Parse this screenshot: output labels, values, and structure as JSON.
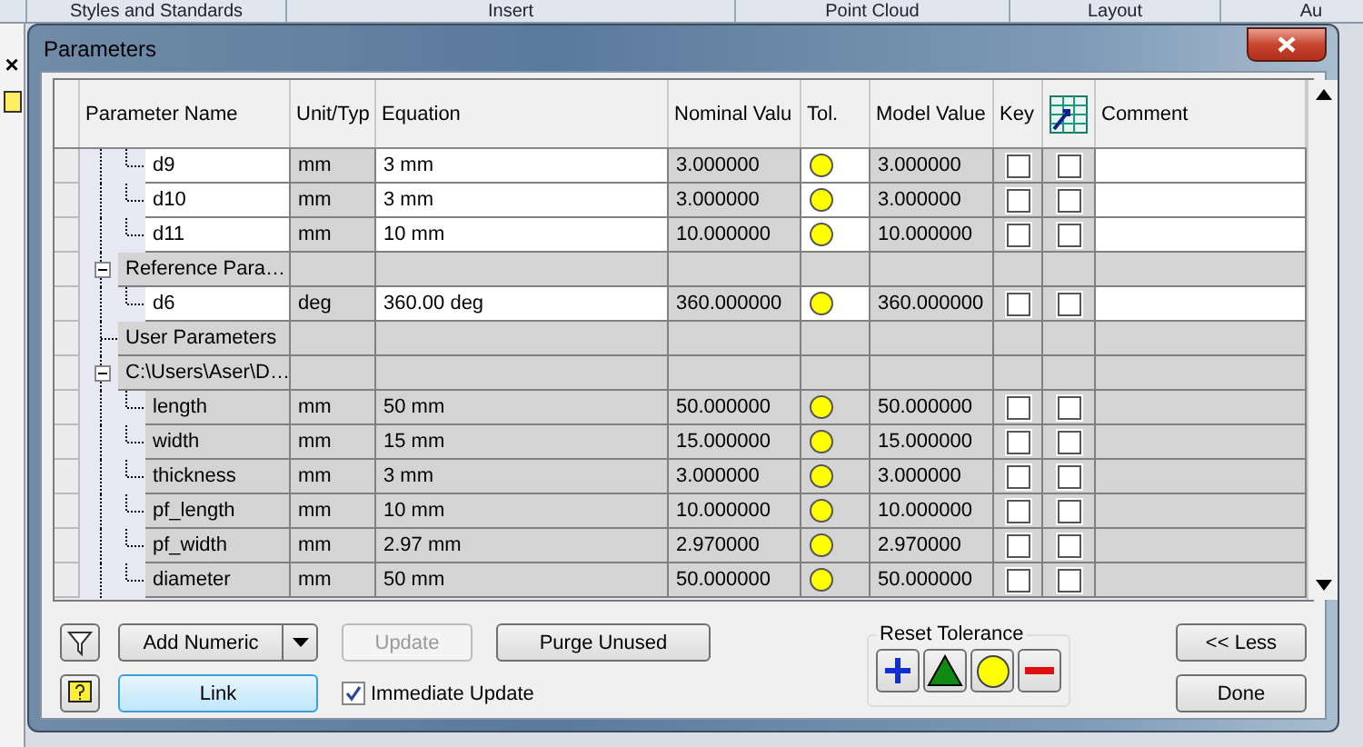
{
  "app_tabs": [
    "Styles and Standards",
    "Insert",
    "Point Cloud",
    "Layout",
    "Au"
  ],
  "side_panel": {
    "close": "×"
  },
  "window": {
    "title": "Parameters"
  },
  "table": {
    "columns": [
      {
        "kind": "text",
        "label": "Parameter Name"
      },
      {
        "kind": "text",
        "label": "Unit/Typ"
      },
      {
        "kind": "text",
        "label": "Equation"
      },
      {
        "kind": "text",
        "label": "Nominal Valu"
      },
      {
        "kind": "text",
        "label": "Tol."
      },
      {
        "kind": "text",
        "label": "Model Value"
      },
      {
        "kind": "text",
        "label": "Key"
      },
      {
        "kind": "icon"
      },
      {
        "kind": "text",
        "label": "Comment"
      }
    ],
    "rows": [
      {
        "kind": "param",
        "name": "d9",
        "unit": "mm",
        "equation": "3 mm",
        "nominal": "3.000000",
        "model": "3.000000",
        "key": false,
        "export": false,
        "shaded": false
      },
      {
        "kind": "param",
        "name": "d10",
        "unit": "mm",
        "equation": "3 mm",
        "nominal": "3.000000",
        "model": "3.000000",
        "key": false,
        "export": false,
        "shaded": false
      },
      {
        "kind": "param",
        "name": "d11",
        "unit": "mm",
        "equation": "10 mm",
        "nominal": "10.000000",
        "model": "10.000000",
        "key": false,
        "export": false,
        "shaded": false
      },
      {
        "kind": "group",
        "name": "Reference Para…",
        "expanded": true,
        "children": [
          {
            "kind": "param",
            "name": "d6",
            "unit": "deg",
            "equation": "360.00 deg",
            "nominal": "360.000000",
            "model": "360.000000",
            "key": false,
            "export": false,
            "shaded": false
          }
        ]
      },
      {
        "kind": "group",
        "name": "User Parameters"
      },
      {
        "kind": "group",
        "name": "C:\\Users\\Aser\\D…",
        "expanded": true,
        "children": [
          {
            "kind": "param",
            "name": "length",
            "unit": "mm",
            "equation": "50 mm",
            "nominal": "50.000000",
            "model": "50.000000",
            "key": false,
            "export": false,
            "shaded": true
          },
          {
            "kind": "param",
            "name": "width",
            "unit": "mm",
            "equation": "15 mm",
            "nominal": "15.000000",
            "model": "15.000000",
            "key": false,
            "export": false,
            "shaded": true
          },
          {
            "kind": "param",
            "name": "thickness",
            "unit": "mm",
            "equation": "3 mm",
            "nominal": "3.000000",
            "model": "3.000000",
            "key": false,
            "export": false,
            "shaded": true
          },
          {
            "kind": "param",
            "name": "pf_length",
            "unit": "mm",
            "equation": "10 mm",
            "nominal": "10.000000",
            "model": "10.000000",
            "key": false,
            "export": false,
            "shaded": true
          },
          {
            "kind": "param",
            "name": "pf_width",
            "unit": "mm",
            "equation": "2.97 mm",
            "nominal": "2.970000",
            "model": "2.970000",
            "key": false,
            "export": false,
            "shaded": true
          },
          {
            "kind": "param",
            "name": "diameter",
            "unit": "mm",
            "equation": "50 mm",
            "nominal": "50.000000",
            "model": "50.000000",
            "key": false,
            "export": false,
            "shaded": true
          }
        ]
      }
    ]
  },
  "buttons": {
    "add_numeric": "Add Numeric",
    "update": {
      "label": "Update",
      "disabled": true
    },
    "purge": "Purge Unused",
    "link": {
      "label": "Link",
      "selected": true
    },
    "immediate_update": {
      "label": "Immediate Update",
      "checked": true
    },
    "less": "<< Less",
    "done": "Done"
  },
  "reset_tolerance": {
    "title": "Reset Tolerance",
    "buttons": [
      {
        "kind": "upper"
      },
      {
        "kind": "median"
      },
      {
        "kind": "nominal"
      },
      {
        "kind": "lower"
      }
    ]
  }
}
